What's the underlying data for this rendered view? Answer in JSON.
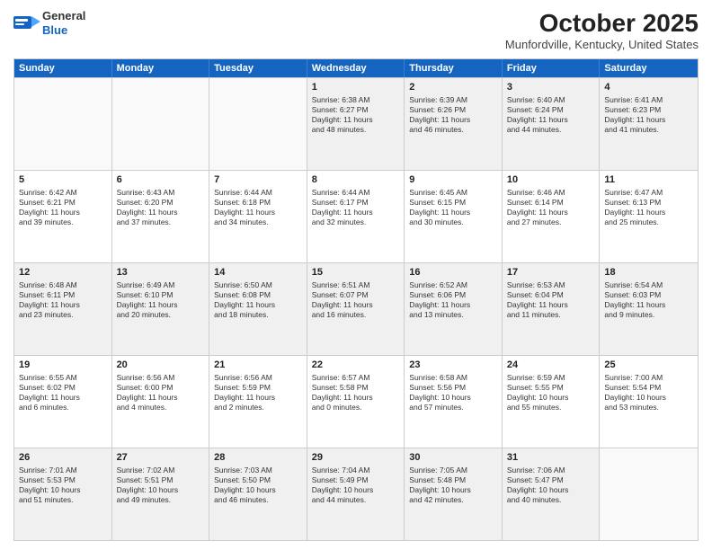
{
  "header": {
    "logo_general": "General",
    "logo_blue": "Blue",
    "month_title": "October 2025",
    "location": "Munfordville, Kentucky, United States"
  },
  "days_of_week": [
    "Sunday",
    "Monday",
    "Tuesday",
    "Wednesday",
    "Thursday",
    "Friday",
    "Saturday"
  ],
  "rows": [
    [
      {
        "day": "",
        "text": "",
        "empty": true
      },
      {
        "day": "",
        "text": "",
        "empty": true
      },
      {
        "day": "",
        "text": "",
        "empty": true
      },
      {
        "day": "1",
        "text": "Sunrise: 6:38 AM\nSunset: 6:27 PM\nDaylight: 11 hours\nand 48 minutes."
      },
      {
        "day": "2",
        "text": "Sunrise: 6:39 AM\nSunset: 6:26 PM\nDaylight: 11 hours\nand 46 minutes."
      },
      {
        "day": "3",
        "text": "Sunrise: 6:40 AM\nSunset: 6:24 PM\nDaylight: 11 hours\nand 44 minutes."
      },
      {
        "day": "4",
        "text": "Sunrise: 6:41 AM\nSunset: 6:23 PM\nDaylight: 11 hours\nand 41 minutes."
      }
    ],
    [
      {
        "day": "5",
        "text": "Sunrise: 6:42 AM\nSunset: 6:21 PM\nDaylight: 11 hours\nand 39 minutes."
      },
      {
        "day": "6",
        "text": "Sunrise: 6:43 AM\nSunset: 6:20 PM\nDaylight: 11 hours\nand 37 minutes."
      },
      {
        "day": "7",
        "text": "Sunrise: 6:44 AM\nSunset: 6:18 PM\nDaylight: 11 hours\nand 34 minutes."
      },
      {
        "day": "8",
        "text": "Sunrise: 6:44 AM\nSunset: 6:17 PM\nDaylight: 11 hours\nand 32 minutes."
      },
      {
        "day": "9",
        "text": "Sunrise: 6:45 AM\nSunset: 6:15 PM\nDaylight: 11 hours\nand 30 minutes."
      },
      {
        "day": "10",
        "text": "Sunrise: 6:46 AM\nSunset: 6:14 PM\nDaylight: 11 hours\nand 27 minutes."
      },
      {
        "day": "11",
        "text": "Sunrise: 6:47 AM\nSunset: 6:13 PM\nDaylight: 11 hours\nand 25 minutes."
      }
    ],
    [
      {
        "day": "12",
        "text": "Sunrise: 6:48 AM\nSunset: 6:11 PM\nDaylight: 11 hours\nand 23 minutes."
      },
      {
        "day": "13",
        "text": "Sunrise: 6:49 AM\nSunset: 6:10 PM\nDaylight: 11 hours\nand 20 minutes."
      },
      {
        "day": "14",
        "text": "Sunrise: 6:50 AM\nSunset: 6:08 PM\nDaylight: 11 hours\nand 18 minutes."
      },
      {
        "day": "15",
        "text": "Sunrise: 6:51 AM\nSunset: 6:07 PM\nDaylight: 11 hours\nand 16 minutes."
      },
      {
        "day": "16",
        "text": "Sunrise: 6:52 AM\nSunset: 6:06 PM\nDaylight: 11 hours\nand 13 minutes."
      },
      {
        "day": "17",
        "text": "Sunrise: 6:53 AM\nSunset: 6:04 PM\nDaylight: 11 hours\nand 11 minutes."
      },
      {
        "day": "18",
        "text": "Sunrise: 6:54 AM\nSunset: 6:03 PM\nDaylight: 11 hours\nand 9 minutes."
      }
    ],
    [
      {
        "day": "19",
        "text": "Sunrise: 6:55 AM\nSunset: 6:02 PM\nDaylight: 11 hours\nand 6 minutes."
      },
      {
        "day": "20",
        "text": "Sunrise: 6:56 AM\nSunset: 6:00 PM\nDaylight: 11 hours\nand 4 minutes."
      },
      {
        "day": "21",
        "text": "Sunrise: 6:56 AM\nSunset: 5:59 PM\nDaylight: 11 hours\nand 2 minutes."
      },
      {
        "day": "22",
        "text": "Sunrise: 6:57 AM\nSunset: 5:58 PM\nDaylight: 11 hours\nand 0 minutes."
      },
      {
        "day": "23",
        "text": "Sunrise: 6:58 AM\nSunset: 5:56 PM\nDaylight: 10 hours\nand 57 minutes."
      },
      {
        "day": "24",
        "text": "Sunrise: 6:59 AM\nSunset: 5:55 PM\nDaylight: 10 hours\nand 55 minutes."
      },
      {
        "day": "25",
        "text": "Sunrise: 7:00 AM\nSunset: 5:54 PM\nDaylight: 10 hours\nand 53 minutes."
      }
    ],
    [
      {
        "day": "26",
        "text": "Sunrise: 7:01 AM\nSunset: 5:53 PM\nDaylight: 10 hours\nand 51 minutes."
      },
      {
        "day": "27",
        "text": "Sunrise: 7:02 AM\nSunset: 5:51 PM\nDaylight: 10 hours\nand 49 minutes."
      },
      {
        "day": "28",
        "text": "Sunrise: 7:03 AM\nSunset: 5:50 PM\nDaylight: 10 hours\nand 46 minutes."
      },
      {
        "day": "29",
        "text": "Sunrise: 7:04 AM\nSunset: 5:49 PM\nDaylight: 10 hours\nand 44 minutes."
      },
      {
        "day": "30",
        "text": "Sunrise: 7:05 AM\nSunset: 5:48 PM\nDaylight: 10 hours\nand 42 minutes."
      },
      {
        "day": "31",
        "text": "Sunrise: 7:06 AM\nSunset: 5:47 PM\nDaylight: 10 hours\nand 40 minutes."
      },
      {
        "day": "",
        "text": "",
        "empty": true
      }
    ]
  ]
}
